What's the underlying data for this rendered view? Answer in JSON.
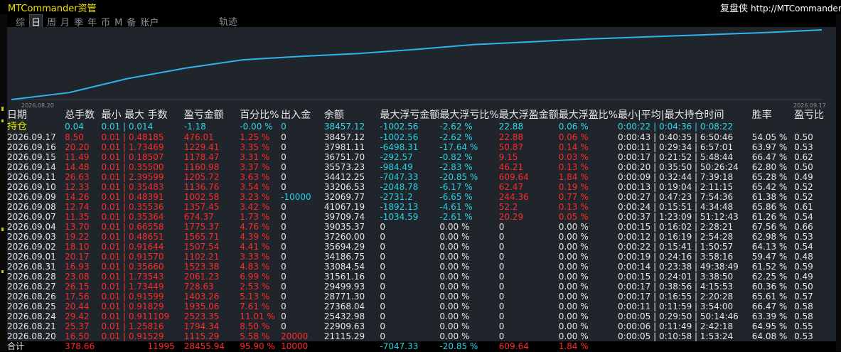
{
  "title": "MTCommander资管",
  "brand": {
    "name": "复盘侠",
    "url": "http://MTCommander"
  },
  "tabs": [
    {
      "label": "综",
      "active": false
    },
    {
      "label": "日",
      "active": true
    },
    {
      "label": "周",
      "active": false
    },
    {
      "label": "月",
      "active": false
    },
    {
      "label": "季",
      "active": false
    },
    {
      "label": "年",
      "active": false
    },
    {
      "label": "币",
      "active": false
    },
    {
      "label": "M",
      "active": false
    },
    {
      "label": "备",
      "active": false
    },
    {
      "label": "账户",
      "active": false
    }
  ],
  "trajectory_label": "轨迹",
  "colors": {
    "line": "#2fb2ee",
    "profit": "#ff2a2a",
    "loss": "#22d3e6",
    "text": "#e8e8e8",
    "accent": "#e6e600",
    "panel": "#20252b"
  },
  "chart_data": {
    "type": "line",
    "x_start_label": "2026.08.20",
    "x_end_label": "2026.09.17",
    "points": [
      0.0,
      0.1,
      0.3,
      0.45,
      0.57,
      0.62,
      0.66,
      0.72,
      0.79,
      0.83,
      0.87,
      0.9,
      0.93,
      0.96,
      1.0
    ]
  },
  "columns": [
    "日期",
    "总手数",
    "最小",
    "最大",
    "手数",
    "盈亏金额",
    "百分比%",
    "出入金",
    "余额",
    "最大浮亏金额",
    "最大浮亏比%",
    "最大浮盈金额",
    "最大浮盈比%",
    "最小|平均|最大持仓时间",
    "胜率",
    "盈亏比"
  ],
  "holding": {
    "label": "持仓",
    "lots": "0.04",
    "minmax": "0.01 | 0.01",
    "count": "4",
    "pnl": "-1.18",
    "pct": "-0.00 %",
    "inout": "0",
    "balance": "38457.12",
    "max_dd": "-1002.56",
    "max_dd_pct": "-2.62 %",
    "max_fp": "22.88",
    "max_fp_pct": "0.06 %",
    "hold_time": "0:00:22 | 0:04:36 | 0:08:22"
  },
  "rows": [
    {
      "date": "2026.09.17",
      "lots": "8.50",
      "minmax": "0.01 | 0.48",
      "count": "185",
      "pnl": "476.01",
      "pct": "1.25 %",
      "inout": "0",
      "balance": "38457.12",
      "max_dd": "-1002.56",
      "max_dd_pct": "-2.62 %",
      "max_fp": "22.88",
      "max_fp_pct": "0.06 %",
      "hold_time": "0:00:43 | 0:40:35 | 6:50:46",
      "win": "54.05 %",
      "ratio": "0.50"
    },
    {
      "date": "2026.09.16",
      "lots": "20.20",
      "minmax": "0.01 | 1.73",
      "count": "469",
      "pnl": "1229.41",
      "pct": "3.35 %",
      "inout": "0",
      "balance": "37981.11",
      "max_dd": "-6498.31",
      "max_dd_pct": "-17.64 %",
      "max_fp": "50.87",
      "max_fp_pct": "0.14 %",
      "hold_time": "0:00:11 | 0:29:34 | 6:57:01",
      "win": "63.97 %",
      "ratio": "0.53"
    },
    {
      "date": "2026.09.15",
      "lots": "11.49",
      "minmax": "0.01 | 0.18",
      "count": "507",
      "pnl": "1178.47",
      "pct": "3.31 %",
      "inout": "0",
      "balance": "36751.70",
      "max_dd": "-292.57",
      "max_dd_pct": "-0.82 %",
      "max_fp": "9.15",
      "max_fp_pct": "0.03 %",
      "hold_time": "0:00:17 | 0:21:52 | 5:48:44",
      "win": "66.47 %",
      "ratio": "0.62"
    },
    {
      "date": "2026.09.14",
      "lots": "14.48",
      "minmax": "0.01 | 0.35",
      "count": "500",
      "pnl": "1160.98",
      "pct": "3.37 %",
      "inout": "0",
      "balance": "35573.23",
      "max_dd": "-984.49",
      "max_dd_pct": "-2.83 %",
      "max_fp": "46.21",
      "max_fp_pct": "0.13 %",
      "hold_time": "0:00:20 | 0:35:50 | 50:26:24",
      "win": "62.80 %",
      "ratio": "0.50"
    },
    {
      "date": "2026.09.11",
      "lots": "26.63",
      "minmax": "0.01 | 2.39",
      "count": "599",
      "pnl": "1205.72",
      "pct": "3.63 %",
      "inout": "0",
      "balance": "34412.25",
      "max_dd": "-7047.33",
      "max_dd_pct": "-20.85 %",
      "max_fp": "609.64",
      "max_fp_pct": "1.84 %",
      "hold_time": "0:00:09 | 0:32:44 | 7:39:18",
      "win": "65.28 %",
      "ratio": "0.49"
    },
    {
      "date": "2026.09.10",
      "lots": "12.33",
      "minmax": "0.01 | 0.35",
      "count": "483",
      "pnl": "1136.76",
      "pct": "3.54 %",
      "inout": "0",
      "balance": "33206.53",
      "max_dd": "-2048.78",
      "max_dd_pct": "-6.17 %",
      "max_fp": "62.47",
      "max_fp_pct": "0.19 %",
      "hold_time": "0:00:13 | 0:19:04 | 2:11:15",
      "win": "65.42 %",
      "ratio": "0.52"
    },
    {
      "date": "2026.09.09",
      "lots": "14.26",
      "minmax": "0.01 | 0.48",
      "count": "391",
      "pnl": "1002.58",
      "pct": "3.23 %",
      "inout": "-10000",
      "balance": "32069.77",
      "max_dd": "-2731.2",
      "max_dd_pct": "-6.65 %",
      "max_fp": "244.36",
      "max_fp_pct": "0.77 %",
      "hold_time": "0:00:27 | 0:47:23 | 7:54:36",
      "win": "61.38 %",
      "ratio": "0.52"
    },
    {
      "date": "2026.09.08",
      "lots": "12.74",
      "minmax": "0.01 | 0.35",
      "count": "536",
      "pnl": "1357.45",
      "pct": "3.42 %",
      "inout": "0",
      "balance": "41067.19",
      "max_dd": "-1892.13",
      "max_dd_pct": "-4.61 %",
      "max_fp": "52.2",
      "max_fp_pct": "0.13 %",
      "hold_time": "0:00:24 | 0:15:51 | 4:34:48",
      "win": "65.86 %",
      "ratio": "0.61"
    },
    {
      "date": "2026.09.07",
      "lots": "11.35",
      "minmax": "0.01 | 0.35",
      "count": "364",
      "pnl": "674.37",
      "pct": "1.73 %",
      "inout": "0",
      "balance": "39709.74",
      "max_dd": "-1034.59",
      "max_dd_pct": "-2.61 %",
      "max_fp": "20.29",
      "max_fp_pct": "0.05 %",
      "hold_time": "0:00:37 | 1:23:09 | 51:12:43",
      "win": "61.26 %",
      "ratio": "0.54"
    },
    {
      "date": "2026.09.04",
      "lots": "13.70",
      "minmax": "0.01 | 0.66",
      "count": "558",
      "pnl": "1775.37",
      "pct": "4.76 %",
      "inout": "0",
      "balance": "39035.37",
      "max_dd": "0",
      "max_dd_pct": "0.00 %",
      "max_fp": "0",
      "max_fp_pct": "0.00 %",
      "hold_time": "0:00:15 | 0:16:02 | 2:28:21",
      "win": "67.56 %",
      "ratio": "0.66"
    },
    {
      "date": "2026.09.03",
      "lots": "19.22",
      "minmax": "0.01 | 0.48",
      "count": "651",
      "pnl": "1565.71",
      "pct": "4.39 %",
      "inout": "0",
      "balance": "37260.00",
      "max_dd": "0",
      "max_dd_pct": "0.00 %",
      "max_fp": "0",
      "max_fp_pct": "0.00 %",
      "hold_time": "0:00:12 | 0:16:19 | 2:54:28",
      "win": "62.98 %",
      "ratio": "0.53"
    },
    {
      "date": "2026.09.02",
      "lots": "18.10",
      "minmax": "0.01 | 0.91",
      "count": "644",
      "pnl": "1507.54",
      "pct": "4.41 %",
      "inout": "0",
      "balance": "35694.29",
      "max_dd": "0",
      "max_dd_pct": "0.00 %",
      "max_fp": "0",
      "max_fp_pct": "0.00 %",
      "hold_time": "0:00:22 | 0:15:41 | 1:50:57",
      "win": "64.13 %",
      "ratio": "0.54"
    },
    {
      "date": "2026.09.01",
      "lots": "20.17",
      "minmax": "0.01 | 0.91",
      "count": "570",
      "pnl": "1102.21",
      "pct": "3.33 %",
      "inout": "0",
      "balance": "34186.75",
      "max_dd": "0",
      "max_dd_pct": "0.00 %",
      "max_fp": "0",
      "max_fp_pct": "0.00 %",
      "hold_time": "0:00:19 | 0:24:16 | 3:58:16",
      "win": "59.47 %",
      "ratio": "0.48"
    },
    {
      "date": "2026.08.31",
      "lots": "16.93",
      "minmax": "0.01 | 0.35",
      "count": "660",
      "pnl": "1523.38",
      "pct": "4.83 %",
      "inout": "0",
      "balance": "33084.54",
      "max_dd": "0",
      "max_dd_pct": "0.00 %",
      "max_fp": "0",
      "max_fp_pct": "0.00 %",
      "hold_time": "0:00:14 | 0:23:38 | 49:38:49",
      "win": "61.52 %",
      "ratio": "0.59"
    },
    {
      "date": "2026.08.28",
      "lots": "23.08",
      "minmax": "0.01 | 1.73",
      "count": "543",
      "pnl": "2061.23",
      "pct": "6.99 %",
      "inout": "0",
      "balance": "31561.16",
      "max_dd": "0",
      "max_dd_pct": "0.00 %",
      "max_fp": "0",
      "max_fp_pct": "0.00 %",
      "hold_time": "0:00:15 | 0:24:01 | 3:38:50",
      "win": "62.25 %",
      "ratio": "0.49"
    },
    {
      "date": "2026.08.27",
      "lots": "26.15",
      "minmax": "0.01 | 1.73",
      "count": "449",
      "pnl": "728.63",
      "pct": "2.53 %",
      "inout": "0",
      "balance": "29499.93",
      "max_dd": "0",
      "max_dd_pct": "0.00 %",
      "max_fp": "0",
      "max_fp_pct": "0.00 %",
      "hold_time": "0:00:17 | 0:38:56 | 4:15:53",
      "win": "60.36 %",
      "ratio": "0.50"
    },
    {
      "date": "2026.08.26",
      "lots": "17.56",
      "minmax": "0.01 | 0.91",
      "count": "599",
      "pnl": "1403.26",
      "pct": "5.13 %",
      "inout": "0",
      "balance": "28771.30",
      "max_dd": "0",
      "max_dd_pct": "0.00 %",
      "max_fp": "0",
      "max_fp_pct": "0.00 %",
      "hold_time": "0:00:17 | 0:16:55 | 2:20:28",
      "win": "65.61 %",
      "ratio": "0.57"
    },
    {
      "date": "2026.08.25",
      "lots": "20.44",
      "minmax": "0.01 | 0.91",
      "count": "829",
      "pnl": "1935.06",
      "pct": "7.61 %",
      "inout": "0",
      "balance": "27368.04",
      "max_dd": "0",
      "max_dd_pct": "0.00 %",
      "max_fp": "0",
      "max_fp_pct": "0.00 %",
      "hold_time": "0:00:11 | 0:11:59 | 3:54:00",
      "win": "66.47 %",
      "ratio": "0.58"
    },
    {
      "date": "2026.08.24",
      "lots": "29.42",
      "minmax": "0.01 | 0.91",
      "count": "1109",
      "pnl": "2523.35",
      "pct": "11.01 %",
      "inout": "0",
      "balance": "25432.98",
      "max_dd": "0",
      "max_dd_pct": "0.00 %",
      "max_fp": "0",
      "max_fp_pct": "0.00 %",
      "hold_time": "0:00:05 | 0:29:50 | 50:14:46",
      "win": "63.39 %",
      "ratio": "0.58"
    },
    {
      "date": "2026.08.21",
      "lots": "25.37",
      "minmax": "0.01 | 1.25",
      "count": "816",
      "pnl": "1794.34",
      "pct": "8.50 %",
      "inout": "0",
      "balance": "22909.63",
      "max_dd": "0",
      "max_dd_pct": "0.00 %",
      "max_fp": "0",
      "max_fp_pct": "0.00 %",
      "hold_time": "0:00:06 | 0:11:49 | 2:42:18",
      "win": "64.95 %",
      "ratio": "0.55"
    },
    {
      "date": "2026.08.20",
      "lots": "16.50",
      "minmax": "0.01 | 0.91",
      "count": "529",
      "pnl": "1115.29",
      "pct": "5.58 %",
      "inout": "20000",
      "balance": "21115.29",
      "max_dd": "0",
      "max_dd_pct": "0.00 %",
      "max_fp": "0",
      "max_fp_pct": "0.00 %",
      "hold_time": "0:00:05 | 0:10:58 | 1:53:24",
      "win": "64.08 %",
      "ratio": "0.53"
    }
  ],
  "totals": {
    "label": "合计",
    "lots": "378.66",
    "count": "11995",
    "pnl": "28455.94",
    "pct": "95.90 %",
    "inout": "10000",
    "max_dd": "-7047.33",
    "max_dd_pct": "-20.85 %",
    "max_fp": "609.64",
    "max_fp_pct": "1.84 %"
  }
}
